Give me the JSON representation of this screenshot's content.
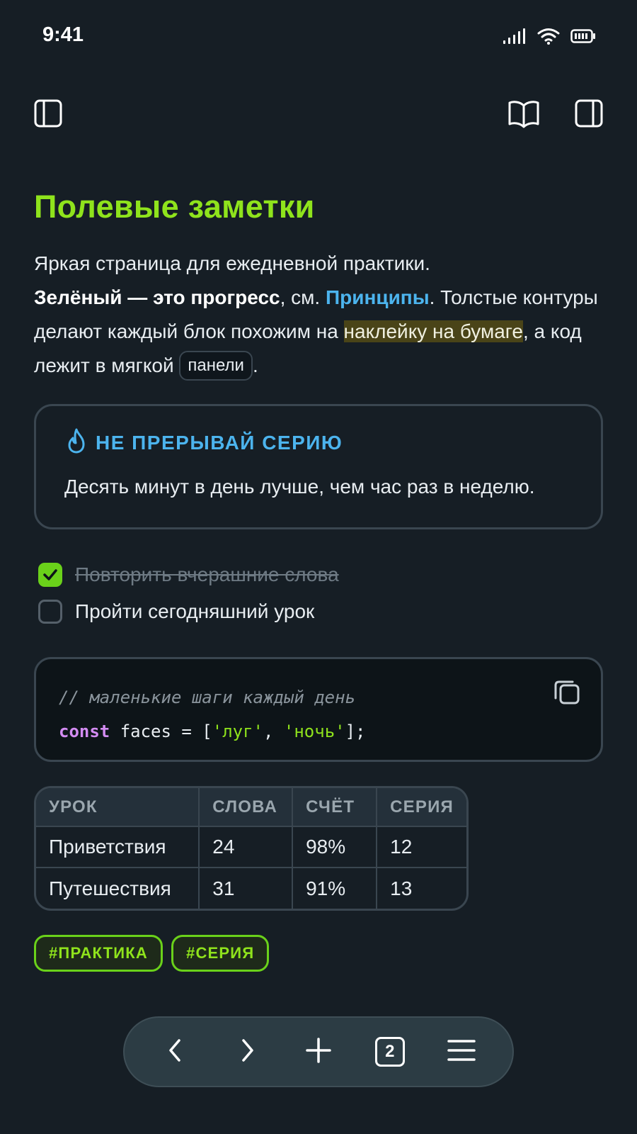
{
  "status_bar": {
    "time": "9:41"
  },
  "article": {
    "title": "Полевые заметки",
    "intro": {
      "line1": "Яркая страница для ежедневной практики.",
      "bold": "Зелёный — это прогресс",
      "sep": ", см. ",
      "link": "Принципы",
      "after_link": ". Толстые контуры делают каждый блок похожим на ",
      "highlight": "наклейку на бумаге",
      "after_highlight": ", а код лежит в мягкой ",
      "kbd": "панели",
      "end": "."
    },
    "callout": {
      "icon": "flame-icon",
      "title": "НЕ ПРЕРЫВАЙ СЕРИЮ",
      "body": "Десять минут в день лучше, чем час раз в неделю."
    },
    "tasks": [
      {
        "label": "Повторить вчерашние слова",
        "done": true
      },
      {
        "label": "Пройти сегодняшний урок",
        "done": false
      }
    ],
    "code": {
      "comment": "// маленькие шаги каждый день",
      "keyword": "const",
      "ident": " faces = [",
      "str1": "'луг'",
      "comma": ", ",
      "str2": "'ночь'",
      "end": "];"
    },
    "table": {
      "headers": [
        "УРОК",
        "СЛОВА",
        "СЧЁТ",
        "СЕРИЯ"
      ],
      "rows": [
        [
          "Приветствия",
          "24",
          "98%",
          "12"
        ],
        [
          "Путешествия",
          "31",
          "91%",
          "13"
        ]
      ]
    },
    "tags": [
      "#ПРАКТИКА",
      "#СЕРИЯ"
    ]
  },
  "bottom_bar": {
    "tabs_count": "2"
  },
  "colors": {
    "accent": "#8fe31c",
    "link": "#4cb4ee",
    "background": "#161e25"
  }
}
